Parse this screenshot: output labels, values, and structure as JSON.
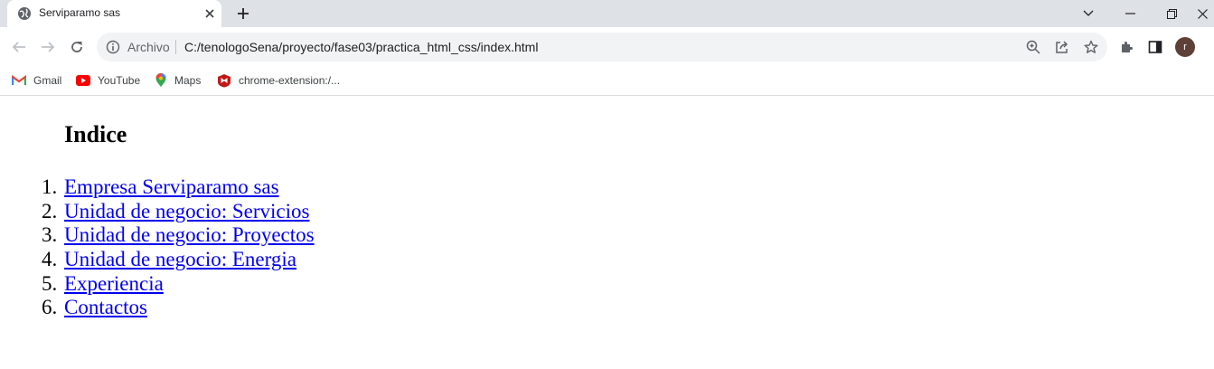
{
  "browser": {
    "tab": {
      "title": "Serviparamo sas"
    },
    "omnibox": {
      "security_label": "Archivo",
      "url": "C:/tenologoSena/proyecto/fase03/practica_html_css/index.html"
    },
    "profile": {
      "initial": "r",
      "color": "#5d4037"
    },
    "bookmarks": [
      {
        "label": "Gmail",
        "icon": "gmail-icon"
      },
      {
        "label": "YouTube",
        "icon": "youtube-icon"
      },
      {
        "label": "Maps",
        "icon": "maps-icon"
      },
      {
        "label": "chrome-extension:/...",
        "icon": "mcafee-icon"
      }
    ]
  },
  "page": {
    "heading": "Indice",
    "items": [
      {
        "number": "1.",
        "label": "Empresa Serviparamo sas"
      },
      {
        "number": "2.",
        "label": "Unidad de negocio: Servicios"
      },
      {
        "number": "3.",
        "label": "Unidad de negocio: Proyectos"
      },
      {
        "number": "4.",
        "label": "Unidad de negocio: Energia"
      },
      {
        "number": "5.",
        "label": "Experiencia"
      },
      {
        "number": "6.",
        "label": "Contactos"
      }
    ]
  },
  "colors": {
    "tabstrip": "#dee1e6",
    "link": "#0000ee",
    "omnibox": "#f1f3f4"
  }
}
